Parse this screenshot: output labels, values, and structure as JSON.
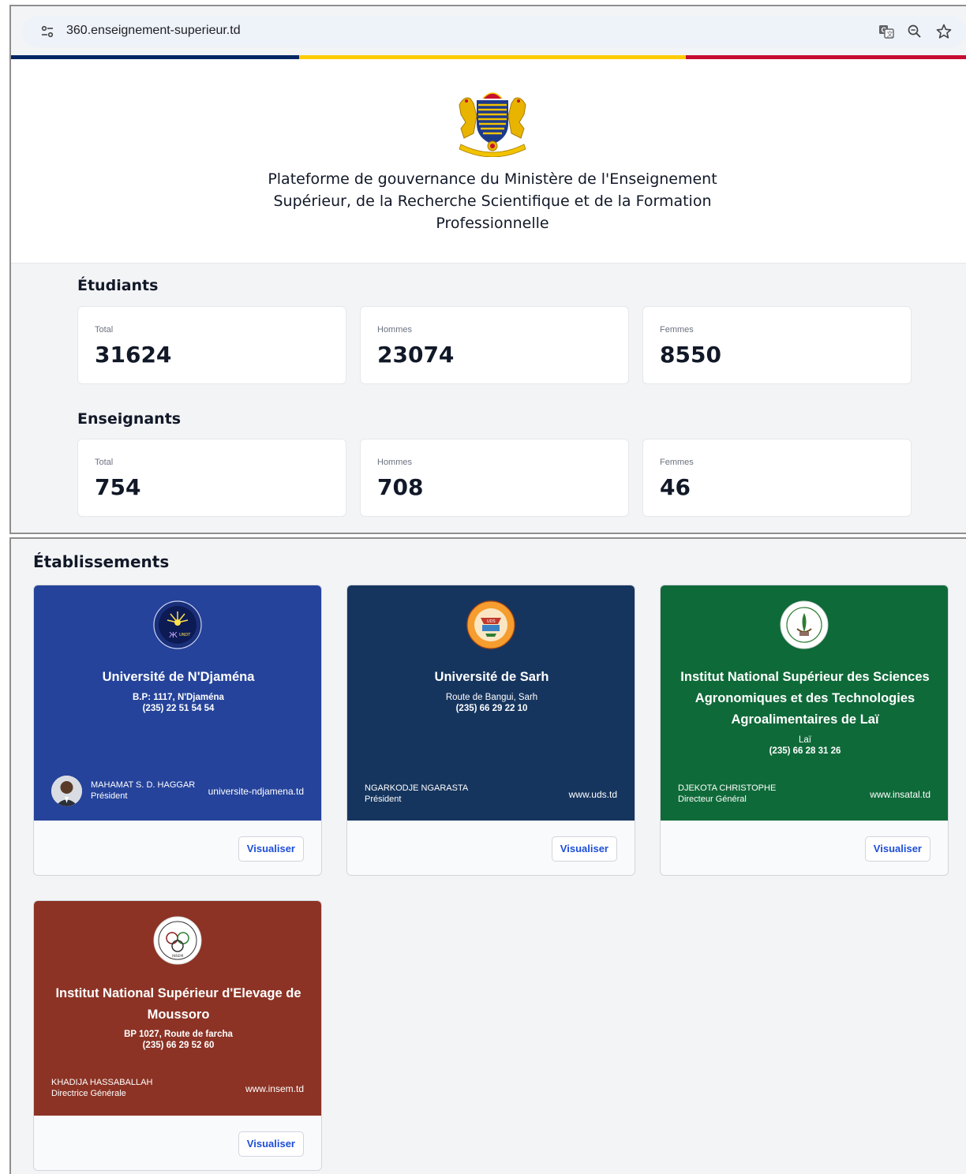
{
  "browser": {
    "url": "360.enseignement-superieur.td",
    "icons": [
      "site-settings-icon",
      "translate-icon",
      "zoom-icon",
      "bookmark-star-icon"
    ]
  },
  "colors": {
    "flag_blue": "#002664",
    "flag_yellow": "#FECB00",
    "flag_red": "#C60C30",
    "link_blue": "#1d4ed8"
  },
  "header": {
    "emblem": "chad-coat-of-arms",
    "emblem_motto": "UNITÉ TRAVAIL PROGRÈS",
    "title": "Plateforme de gouvernance du Ministère de l'Enseignement Supérieur, de la Recherche Scientifique et de la Formation Professionnelle"
  },
  "students": {
    "heading": "Étudiants",
    "total_label": "Total",
    "total": "31624",
    "men_label": "Hommes",
    "men": "23074",
    "women_label": "Femmes",
    "women": "8550"
  },
  "teachers": {
    "heading": "Enseignants",
    "total_label": "Total",
    "total": "754",
    "men_label": "Hommes",
    "men": "708",
    "women_label": "Femmes",
    "women": "46"
  },
  "establishments": {
    "heading": "Établissements",
    "button_label": "Visualiser",
    "items": [
      {
        "name": "Université de N'Djaména",
        "address": "B.P: 1117, N'Djaména",
        "phone": "(235) 22 51 54 54",
        "head_name": "MAHAMAT S. D. HAGGAR",
        "head_role": "Président",
        "website": "universite-ndjamena.td",
        "color": "#25439a"
      },
      {
        "name": "Université de Sarh",
        "address": "Route de Bangui, Sarh",
        "phone": "(235) 66 29 22 10",
        "head_name": "NGARKODJE NGARASTA",
        "head_role": "Président",
        "website": "www.uds.td",
        "color": "#16355e"
      },
      {
        "name": "Institut National Supérieur des Sciences Agronomiques et des Technologies Agroalimentaires de Laï",
        "address": "Laï",
        "phone": "(235) 66 28 31 26",
        "head_name": "DJEKOTA CHRISTOPHE",
        "head_role": "Directeur Général",
        "website": "www.insatal.td",
        "color": "#0f6a39"
      },
      {
        "name": "Institut National Supérieur d'Elevage de Moussoro",
        "address": "BP 1027, Route de farcha",
        "phone": "(235) 66 29 52 60",
        "head_name": "KHADIJA HASSABALLAH",
        "head_role": "Directrice Générale",
        "website": "www.insem.td",
        "color": "#8c3325"
      }
    ]
  }
}
